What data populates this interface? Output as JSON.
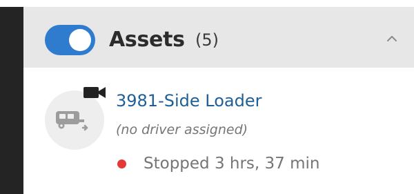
{
  "panel": {
    "title": "Assets",
    "count": "(5)",
    "toggle_on": true,
    "collapse_icon": "chevron-up-icon",
    "accent_color": "#2f7ccf"
  },
  "item": {
    "name": "3981-Side Loader",
    "driver": "(no driver assigned)",
    "status": "Stopped 3 hrs, 37 min",
    "status_color": "#e53935",
    "avatar_icon": "vehicle-icon",
    "badge_icon": "video-camera-icon"
  }
}
